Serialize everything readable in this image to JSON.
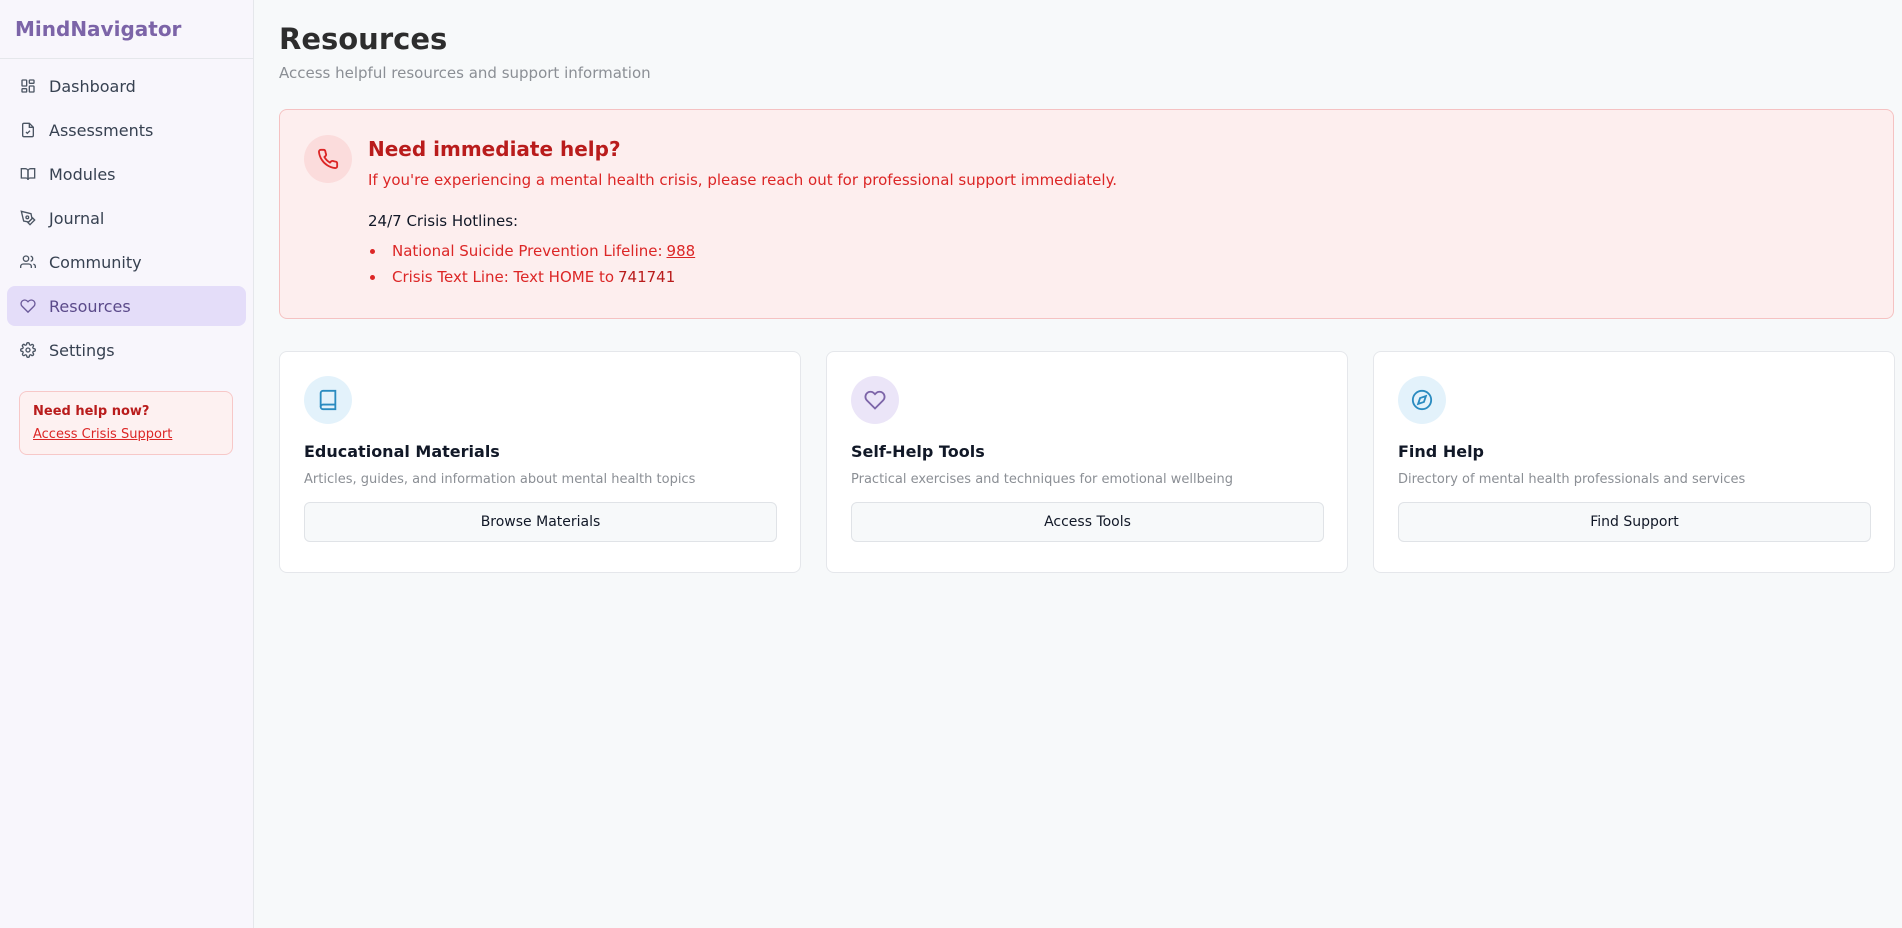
{
  "app": {
    "name": "MindNavigator"
  },
  "sidebar": {
    "items": [
      {
        "label": "Dashboard",
        "icon": "dashboard-icon"
      },
      {
        "label": "Assessments",
        "icon": "clipboard-icon"
      },
      {
        "label": "Modules",
        "icon": "book-open-icon"
      },
      {
        "label": "Journal",
        "icon": "pen-icon"
      },
      {
        "label": "Community",
        "icon": "users-icon"
      },
      {
        "label": "Resources",
        "icon": "heart-icon",
        "active": true
      },
      {
        "label": "Settings",
        "icon": "gear-icon"
      }
    ],
    "help": {
      "title": "Need help now?",
      "link": "Access Crisis Support"
    }
  },
  "page": {
    "title": "Resources",
    "subtitle": "Access helpful resources and support information"
  },
  "crisis": {
    "icon": "phone-icon",
    "title": "Need immediate help?",
    "text": "If you're experiencing a mental health crisis, please reach out for professional support immediately.",
    "hotlines_label": "24/7 Crisis Hotlines:",
    "hotlines": [
      {
        "label": "National Suicide Prevention Lifeline:",
        "number": "988"
      },
      {
        "label": "Crisis Text Line: Text HOME to",
        "number": "741741"
      }
    ]
  },
  "cards": [
    {
      "icon": "book-icon",
      "title": "Educational Materials",
      "description": "Articles, guides, and information about mental health topics",
      "button": "Browse Materials"
    },
    {
      "icon": "heart-icon",
      "title": "Self-Help Tools",
      "description": "Practical exercises and techniques for emotional wellbeing",
      "button": "Access Tools"
    },
    {
      "icon": "compass-icon",
      "title": "Find Help",
      "description": "Directory of mental health professionals and services",
      "button": "Find Support"
    }
  ],
  "colors": {
    "brand": "#7c64a8",
    "active_nav_bg": "#e4ddf9",
    "crisis_red": "#dc2626",
    "crisis_bg": "#fdeeee"
  }
}
